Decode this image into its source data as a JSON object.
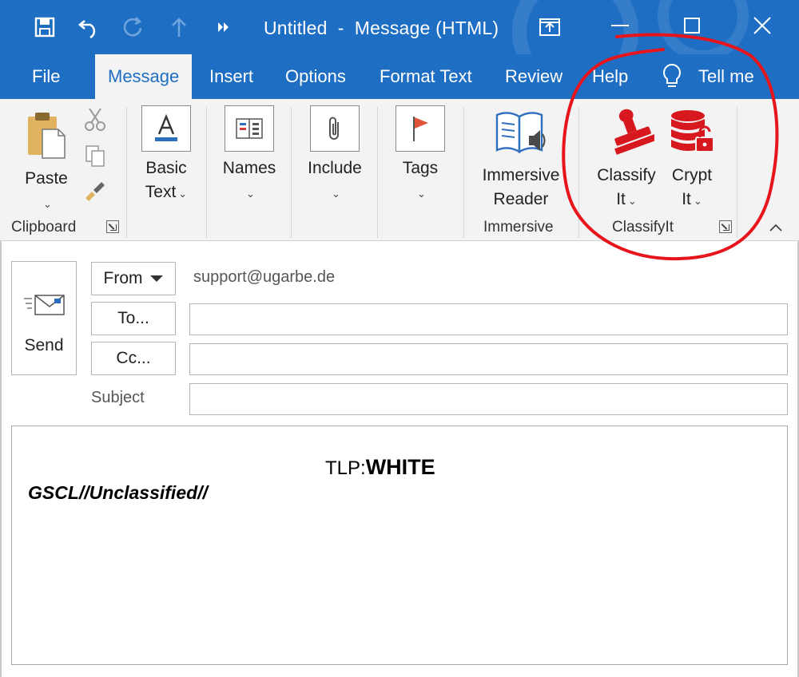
{
  "window": {
    "title": "Untitled  -  Message (HTML)"
  },
  "quick_access": {
    "icons": [
      "save-icon",
      "undo-icon",
      "redo-icon",
      "up-arrow-icon",
      "more-icon"
    ]
  },
  "tabs": [
    {
      "label": "File"
    },
    {
      "label": "Message",
      "active": true
    },
    {
      "label": "Insert"
    },
    {
      "label": "Options"
    },
    {
      "label": "Format Text"
    },
    {
      "label": "Review"
    },
    {
      "label": "Help"
    }
  ],
  "tell_me": "Tell me",
  "ribbon": {
    "clipboard": {
      "paste_label": "Paste",
      "group_label": "Clipboard"
    },
    "basic_text": {
      "line1": "Basic",
      "line2": "Text"
    },
    "names": {
      "label": "Names"
    },
    "include": {
      "label": "Include"
    },
    "tags": {
      "label": "Tags"
    },
    "immersive": {
      "line1": "Immersive",
      "line2": "Reader",
      "group_label": "Immersive"
    },
    "classifyit": {
      "classify_line1": "Classify",
      "classify_line2": "It",
      "crypt_line1": "Crypt",
      "crypt_line2": "It",
      "group_label": "ClassifyIt"
    }
  },
  "compose": {
    "send_label": "Send",
    "from_label": "From",
    "from_value": "support@ugarbe.de",
    "to_label": "To...",
    "cc_label": "Cc...",
    "subject_label": "Subject",
    "to_value": "",
    "cc_value": "",
    "subject_value": ""
  },
  "body": {
    "tlp_prefix": "TLP:",
    "tlp_level": "WHITE",
    "classification": "GSCL//Unclassified//"
  },
  "colors": {
    "accent": "#1e6ec3",
    "ribbon_bg": "#f3f3f3",
    "annotation": "#e8141c",
    "classify_red": "#d7191f"
  }
}
